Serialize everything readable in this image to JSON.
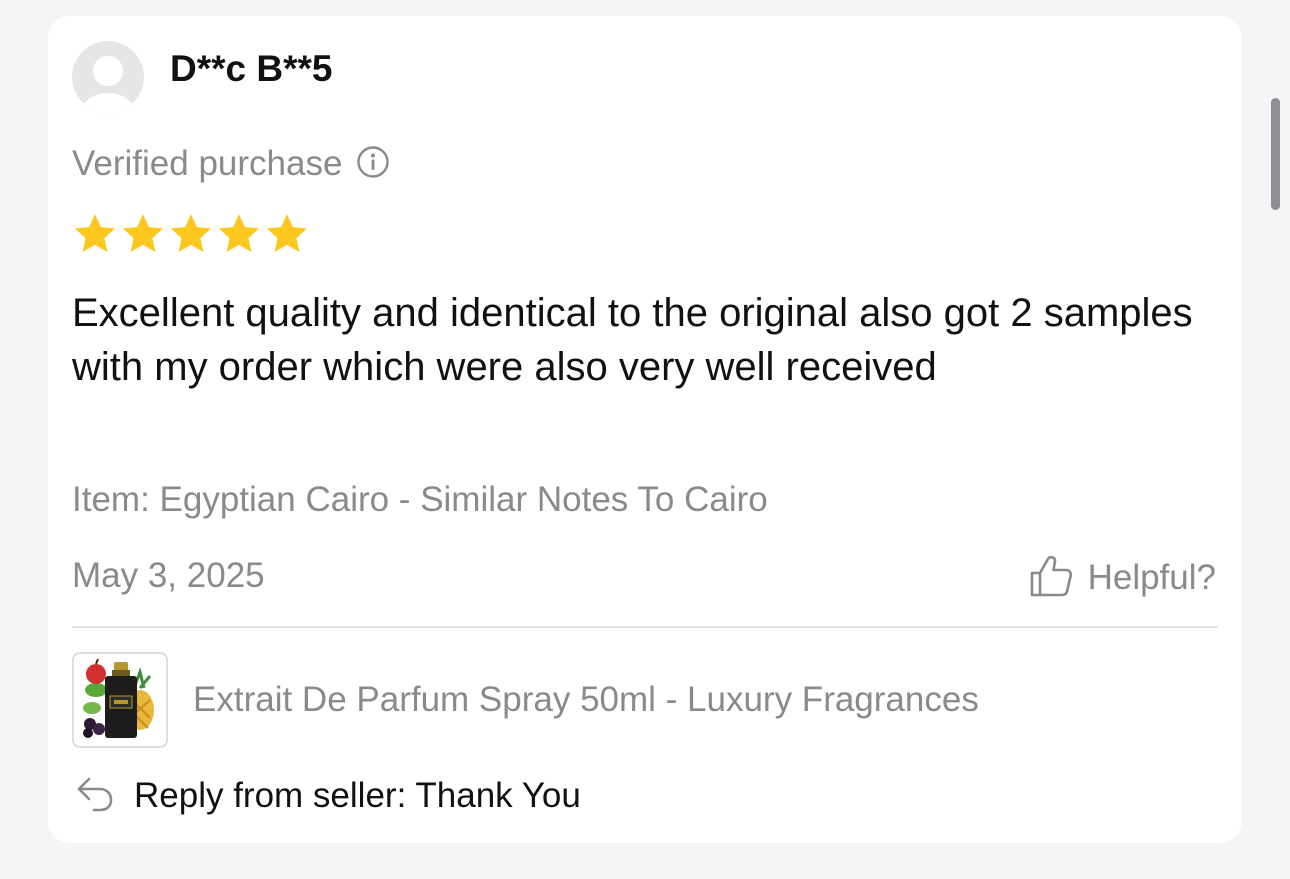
{
  "review": {
    "reviewer_name": "D**c B**5",
    "verified_label": "Verified purchase",
    "rating": 5,
    "rating_max": 5,
    "star_color": "#fcc71e",
    "body": "Excellent quality and identical to the original also got 2 samples with my order which were also very well received",
    "item": "Item: Egyptian Cairo - Similar Notes To Cairo",
    "date": "May 3, 2025",
    "helpful_label": "Helpful?"
  },
  "product": {
    "name": "Extrait De Parfum Spray 50ml - Luxury Fragrances"
  },
  "seller_reply": {
    "text": "Reply from seller: Thank You"
  },
  "icons": {
    "verified_info": "info-icon",
    "helpful": "thumbs-up-icon",
    "reply": "reply-arrow-icon"
  }
}
